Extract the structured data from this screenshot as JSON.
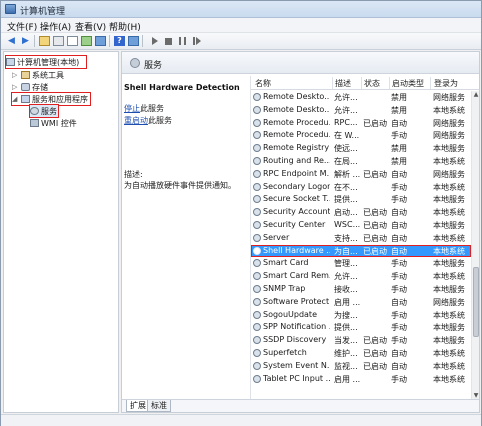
{
  "window": {
    "title": "计算机管理"
  },
  "menu": [
    "文件(F)",
    "操作(A)",
    "查看(V)",
    "帮助(H)"
  ],
  "tree": {
    "root": "计算机管理(本地)",
    "items": [
      {
        "label": "系统工具",
        "level": 1,
        "expander": "▷"
      },
      {
        "label": "存储",
        "level": 1,
        "expander": "▷"
      },
      {
        "label": "服务和应用程序",
        "level": 1,
        "expander": "◢"
      },
      {
        "label": "服务",
        "level": 2,
        "expander": ""
      },
      {
        "label": "WMI 控件",
        "level": 2,
        "expander": ""
      }
    ]
  },
  "right_header": "服务",
  "detail": {
    "service_name": "Shell Hardware Detection",
    "stop_link": "停止",
    "stop_suffix": "此服务",
    "restart_link": "重启动",
    "restart_suffix": "此服务",
    "desc_label": "描述:",
    "desc_text": "为自动播放硬件事件提供通知。"
  },
  "columns": [
    "名称",
    "描述",
    "状态",
    "启动类型",
    "登录为"
  ],
  "services": [
    {
      "name": "Remote Deskto...",
      "desc": "允许...",
      "status": "",
      "startup": "禁用",
      "logon": "网络服务"
    },
    {
      "name": "Remote Deskto...",
      "desc": "允许...",
      "status": "",
      "startup": "禁用",
      "logon": "本地系统"
    },
    {
      "name": "Remote Procedu...",
      "desc": "RPC...",
      "status": "已启动",
      "startup": "自动",
      "logon": "网络服务"
    },
    {
      "name": "Remote Procedu...",
      "desc": "在 W...",
      "status": "",
      "startup": "手动",
      "logon": "网络服务"
    },
    {
      "name": "Remote Registry",
      "desc": "使远...",
      "status": "",
      "startup": "禁用",
      "logon": "本地服务"
    },
    {
      "name": "Routing and Re...",
      "desc": "在局...",
      "status": "",
      "startup": "禁用",
      "logon": "本地系统"
    },
    {
      "name": "RPC Endpoint M...",
      "desc": "解析 ...",
      "status": "已启动",
      "startup": "自动",
      "logon": "网络服务"
    },
    {
      "name": "Secondary Logon",
      "desc": "在不...",
      "status": "",
      "startup": "手动",
      "logon": "本地系统"
    },
    {
      "name": "Secure Socket T...",
      "desc": "提供...",
      "status": "",
      "startup": "手动",
      "logon": "本地服务"
    },
    {
      "name": "Security Account...",
      "desc": "启动...",
      "status": "已启动",
      "startup": "自动",
      "logon": "本地系统"
    },
    {
      "name": "Security Center",
      "desc": "WSC...",
      "status": "已启动",
      "startup": "自动",
      "logon": "本地服务"
    },
    {
      "name": "Server",
      "desc": "支持...",
      "status": "已启动",
      "startup": "自动",
      "logon": "本地系统"
    },
    {
      "name": "Shell Hardware ...",
      "desc": "为自...",
      "status": "已启动",
      "startup": "自动",
      "logon": "本地系统",
      "selected": true
    },
    {
      "name": "Smart Card",
      "desc": "管理...",
      "status": "",
      "startup": "手动",
      "logon": "本地服务"
    },
    {
      "name": "Smart Card Rem...",
      "desc": "允许...",
      "status": "",
      "startup": "手动",
      "logon": "本地系统"
    },
    {
      "name": "SNMP Trap",
      "desc": "接收...",
      "status": "",
      "startup": "手动",
      "logon": "本地服务"
    },
    {
      "name": "Software Protect...",
      "desc": "启用 ...",
      "status": "",
      "startup": "自动",
      "logon": "网络服务"
    },
    {
      "name": "SogouUpdate",
      "desc": "为搜...",
      "status": "",
      "startup": "手动",
      "logon": "本地系统"
    },
    {
      "name": "SPP Notification ...",
      "desc": "提供...",
      "status": "",
      "startup": "手动",
      "logon": "本地服务"
    },
    {
      "name": "SSDP Discovery",
      "desc": "当发...",
      "status": "已启动",
      "startup": "手动",
      "logon": "本地服务"
    },
    {
      "name": "Superfetch",
      "desc": "维护...",
      "status": "已启动",
      "startup": "自动",
      "logon": "本地系统"
    },
    {
      "name": "System Event N...",
      "desc": "监视...",
      "status": "已启动",
      "startup": "自动",
      "logon": "本地系统"
    },
    {
      "name": "Tablet PC Input ...",
      "desc": "启用 ...",
      "status": "",
      "startup": "手动",
      "logon": "本地系统"
    }
  ],
  "tabs": [
    "扩展",
    "标准"
  ],
  "colors": {
    "selected_row": "#3399ff",
    "highlight_box": "#e02020",
    "link": "#1e4fb0"
  },
  "toolbar_icons": [
    "back-arrow-icon",
    "forward-arrow-icon",
    "up-folder-icon",
    "show-hide-tree-icon",
    "export-icon",
    "refresh-icon",
    "properties-icon",
    "help-icon",
    "play-icon",
    "stop-icon",
    "pause-icon",
    "restart-icon"
  ]
}
